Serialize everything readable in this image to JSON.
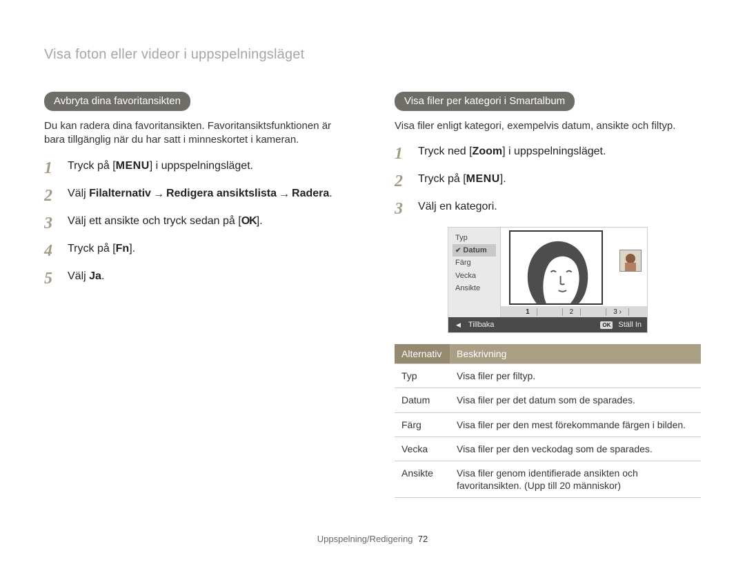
{
  "page_title": "Visa foton eller videor i uppspelningsläget",
  "footer": {
    "section": "Uppspelning/Redigering",
    "page": "72"
  },
  "icons": {
    "menu": "MENU",
    "ok": "OK",
    "fn": "Fn",
    "arrow_right": "→",
    "arrow_left": "◀",
    "chevron_right": "›"
  },
  "left": {
    "heading": "Avbryta dina favoritansikten",
    "intro": "Du kan radera dina favoritansikten. Favoritansiktsfunktionen är bara tillgänglig när du har satt i minneskortet i kameran.",
    "steps": {
      "s1_pre": "Tryck på [",
      "s1_post": "] i uppspelningsläget.",
      "s2_pre": "Välj ",
      "s2_b1": "Filalternativ",
      "s2_b2": "Redigera ansiktslista",
      "s2_b3": "Radera",
      "s3_pre": "Välj ett ansikte och tryck sedan på [",
      "s3_post": "].",
      "s4_pre": "Tryck på [",
      "s4_post": "].",
      "s5_pre": "Välj ",
      "s5_b": "Ja",
      "s5_post": "."
    }
  },
  "right": {
    "heading": "Visa filer per kategori i Smartalbum",
    "intro": "Visa filer enligt kategori, exempelvis datum, ansikte och filtyp.",
    "steps": {
      "s1_pre": "Tryck ned [",
      "s1_b": "Zoom",
      "s1_post": "] i uppspelningsläget.",
      "s2_pre": "Tryck på [",
      "s2_post": "].",
      "s3": "Välj en kategori."
    },
    "lcd": {
      "side": [
        "Typ",
        "Datum",
        "Färg",
        "Vecka",
        "Ansikte"
      ],
      "active_index": 1,
      "pager": [
        "1",
        "2",
        "3"
      ],
      "bottom_back": "Tillbaka",
      "bottom_set": "Ställ In"
    },
    "table": {
      "head_alt": "Alternativ",
      "head_desc": "Beskrivning",
      "rows": [
        {
          "alt": "Typ",
          "desc": "Visa filer per filtyp."
        },
        {
          "alt": "Datum",
          "desc": "Visa filer per det datum som de sparades."
        },
        {
          "alt": "Färg",
          "desc": "Visa filer per den mest förekommande färgen i bilden."
        },
        {
          "alt": "Vecka",
          "desc": "Visa filer per den veckodag som de sparades."
        },
        {
          "alt": "Ansikte",
          "desc": "Visa filer genom identifierade ansikten och favoritansikten. (Upp till 20 människor)"
        }
      ]
    }
  }
}
